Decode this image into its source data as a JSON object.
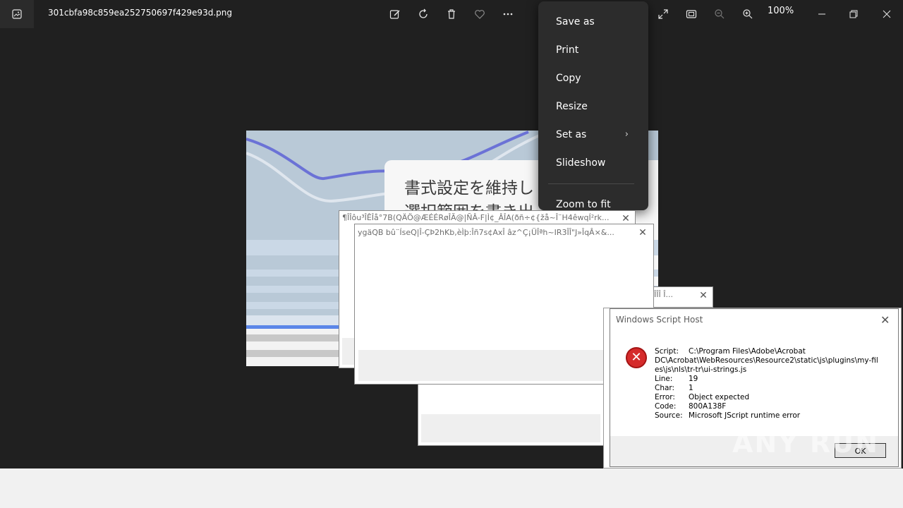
{
  "titlebar": {
    "file_name": "301cbfa98c859ea252750697f429e93d.png",
    "zoom_level": "100%"
  },
  "photo": {
    "jp_line1": "書式設定を維持し",
    "jp_line2": "選択範囲を書き出"
  },
  "context_menu": {
    "items": [
      {
        "label": "Save as"
      },
      {
        "label": "Print"
      },
      {
        "label": "Copy"
      },
      {
        "label": "Resize"
      },
      {
        "label": "Set as"
      },
      {
        "label": "Slideshow"
      },
      {
        "label": "Zoom to fit"
      }
    ]
  },
  "windows": {
    "garbled1_title": "¶ÎÎôu³ÎÊÎå°7B(QÄÖ@ÆÉÉRøÎÃ@|ÑÂ-F|Ì¢_ÂÎA(ðñ÷¢{žå~Î¨H4êwqÍ²rk...",
    "garbled2_title": "ygäQB  bû¨ÍseQ|Î-ÇÞ2hKb,èÌþ:Îñ7s¢AxÎ âz^Ç¡ÜÎªh~IR3ÎÎ\"J»ÎqÂ×&...",
    "garbled3_title": "ÎÎÎ  Î..."
  },
  "wsh_dialog": {
    "title": "Windows Script Host",
    "ok_label": "OK",
    "rows": [
      {
        "label": "Script:",
        "value": "C:\\Program Files\\Adobe\\Acrobat"
      },
      {
        "label": "",
        "value": "DC\\Acrobat\\WebResources\\Resource2\\static\\js\\plugins\\my-fil"
      },
      {
        "label": "",
        "value": "es\\js\\nls\\tr-tr\\ui-strings.js"
      },
      {
        "label": "Line:",
        "value": "19"
      },
      {
        "label": "Char:",
        "value": "1"
      },
      {
        "label": "Error:",
        "value": "Object expected"
      },
      {
        "label": "Code:",
        "value": "800A138F"
      },
      {
        "label": "Source:",
        "value": "Microsoft JScript runtime error"
      }
    ]
  },
  "watermark": "ANY RUN"
}
